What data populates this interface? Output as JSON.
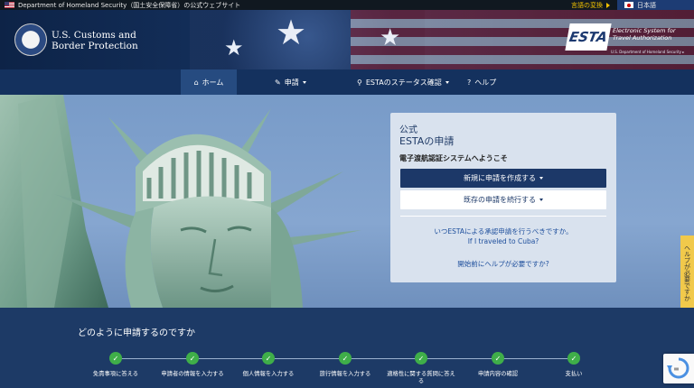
{
  "gov_strip": {
    "site_text": "Department of Homeland Security（国土安全保障省）の公式ウェブサイト",
    "lang_change": "言語の変換",
    "lang_current": "日本語"
  },
  "header": {
    "agency_line1": "U.S. Customs and",
    "agency_line2": "Border Protection",
    "esta_mark": "ESTA",
    "esta_line1": "Electronic System for",
    "esta_line2": "Travel Authorization",
    "esta_sub": "U.S. Department of Homeland Security ▸"
  },
  "nav": {
    "home": "ホーム",
    "apply": "申請",
    "status": "ESTAのステータス確認",
    "help": "ヘルプ"
  },
  "panel": {
    "official": "公式",
    "title": "ESTAの申請",
    "welcome": "電子渡航認証システムへようこそ",
    "new_app": "新規に申請を作成する",
    "continue_app": "既存の申請を続行する",
    "when_apply": "いつESTAによる承認申請を行うべきですか。",
    "cuba": "If I traveled to Cuba?",
    "need_help": "開始前にヘルプが必要ですか?"
  },
  "help_tab": "ヘルプが必要ですか",
  "steps": {
    "title": "どのように申請するのですか",
    "items": [
      {
        "label": "免責事項に答える"
      },
      {
        "label": "申請者の情報を入力する"
      },
      {
        "label": "個人情報を入力する"
      },
      {
        "label": "旅行情報を入力する"
      },
      {
        "label": "適格性に関する質問に答える"
      },
      {
        "label": "申請内容の確認"
      },
      {
        "label": "支払い"
      }
    ]
  },
  "colors": {
    "nav_bg": "#14315e",
    "primary": "#1c3868",
    "step_done": "#3fae49",
    "help_tab": "#f1c94b"
  }
}
